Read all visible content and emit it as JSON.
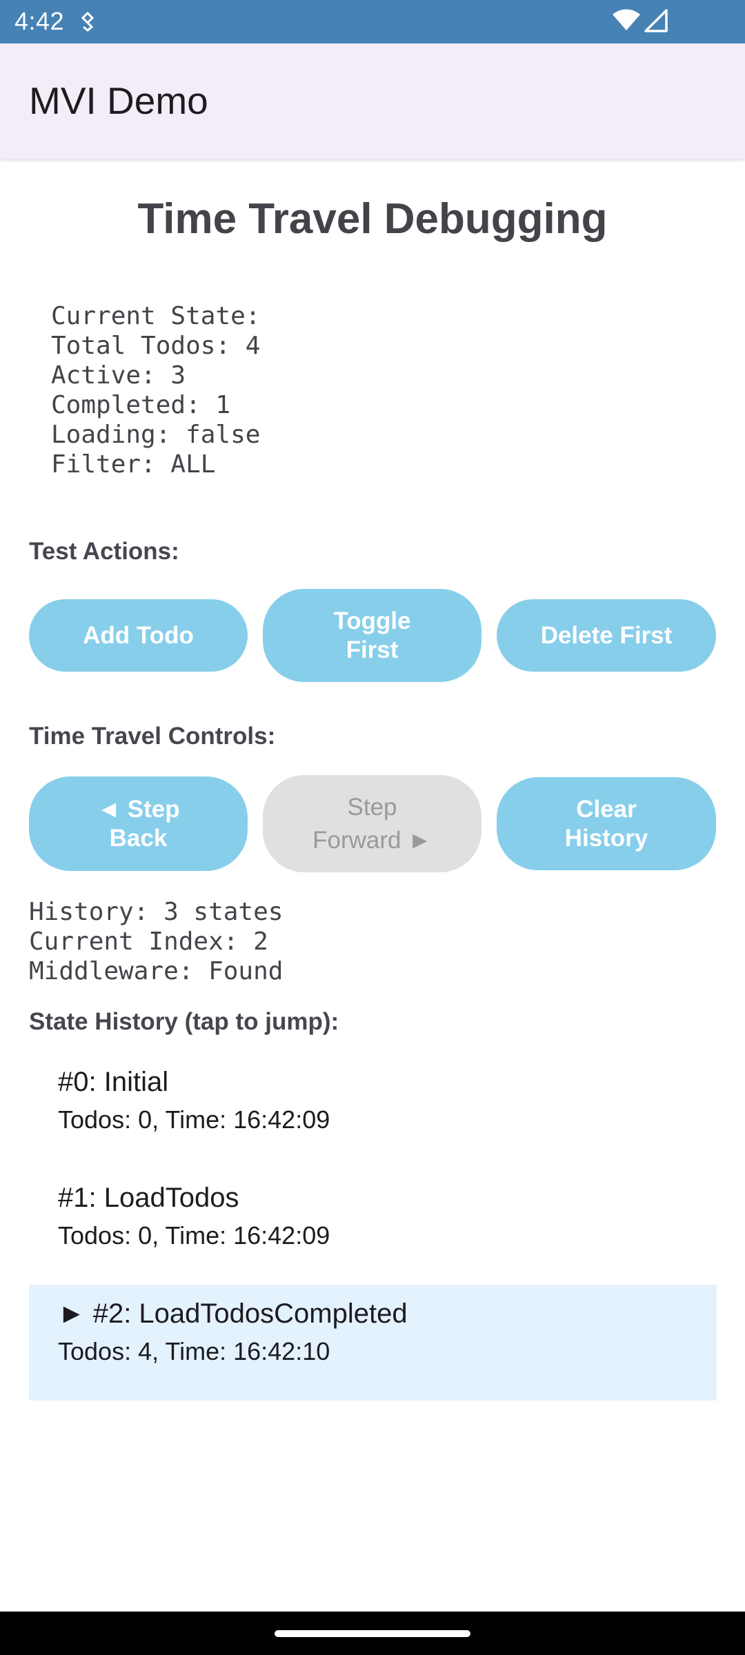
{
  "status_bar": {
    "time": "4:42",
    "icons": [
      "notification-icon",
      "wifi-icon",
      "signal-icon"
    ]
  },
  "app_bar": {
    "title": "MVI Demo"
  },
  "main": {
    "page_title": "Time Travel Debugging",
    "current_state": {
      "lines": [
        "Current State:",
        "Total Todos: 4",
        "Active: 3",
        "Completed: 1",
        "Loading: false",
        "Filter: ALL"
      ]
    },
    "test_actions": {
      "label": "Test Actions:",
      "buttons": {
        "add_todo": "Add Todo",
        "toggle_first_line1": "Toggle",
        "toggle_first_line2": "First",
        "delete_first": "Delete First"
      }
    },
    "time_travel": {
      "label": "Time Travel Controls:",
      "buttons": {
        "step_back_line1": "◄ Step",
        "step_back_line2": "Back",
        "step_forward_line1": "Step",
        "step_forward_line2": "Forward ►",
        "clear_history_line1": "Clear",
        "clear_history_line2": "History"
      },
      "step_forward_enabled": false
    },
    "debug_info": {
      "lines": [
        "History: 3 states",
        "Current Index: 2",
        "Middleware: Found"
      ]
    },
    "state_history": {
      "label": "State History (tap to jump):",
      "items": [
        {
          "title": "#0: Initial",
          "subtitle": "Todos: 0, Time: 16:42:09",
          "current": false
        },
        {
          "title": "#1: LoadTodos",
          "subtitle": "Todos: 0, Time: 16:42:09",
          "current": false
        },
        {
          "title": "► #2: LoadTodosCompleted",
          "subtitle": "Todos: 4, Time: 16:42:10",
          "current": true
        }
      ]
    }
  },
  "colors": {
    "status_bar": "#4682b4",
    "app_bar": "#f2edf7",
    "button": "#87ceeb",
    "button_disabled": "#e0e0e0",
    "selected_history": "#e3f2fd"
  }
}
